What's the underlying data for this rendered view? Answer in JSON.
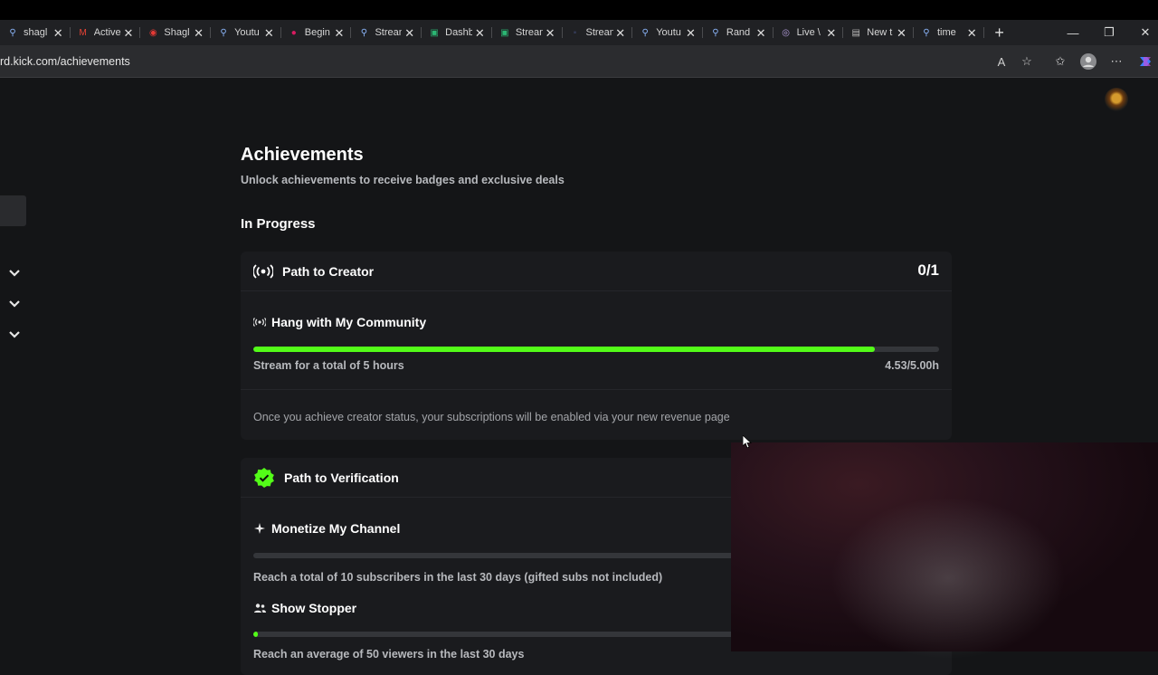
{
  "browser": {
    "tabs": [
      {
        "title": "shagl",
        "icon": "search-icon"
      },
      {
        "title": "Active",
        "icon": "gmail-icon"
      },
      {
        "title": "Shagl",
        "icon": "redcircle-icon"
      },
      {
        "title": "Youtu",
        "icon": "search-icon"
      },
      {
        "title": "Begin",
        "icon": "youtube-icon"
      },
      {
        "title": "Strean",
        "icon": "search-icon"
      },
      {
        "title": "Dashb",
        "icon": "kick-icon"
      },
      {
        "title": "Strean",
        "icon": "kick-icon"
      },
      {
        "title": "Strean",
        "icon": "dark-icon"
      },
      {
        "title": "Youtu",
        "icon": "search-icon"
      },
      {
        "title": "Rand",
        "icon": "search-icon"
      },
      {
        "title": "Live \\",
        "icon": "live-icon"
      },
      {
        "title": "New t",
        "icon": "page-icon"
      },
      {
        "title": "time",
        "icon": "search-icon"
      }
    ],
    "url": "rd.kick.com/achievements"
  },
  "page": {
    "title": "Achievements",
    "subtitle": "Unlock achievements to receive badges and exclusive deals",
    "section": "In Progress"
  },
  "cards": {
    "creator": {
      "name": "Path to Creator",
      "count": "0/1",
      "achievement": {
        "title": "Hang with My Community",
        "desc": "Stream for a total of 5 hours",
        "value": "4.53/5.00h",
        "progress": 0.906
      },
      "note": "Once you achieve creator status, your subscriptions will be enabled via your new revenue page"
    },
    "verification": {
      "name": "Path to Verification",
      "a1": {
        "title": "Monetize My Channel",
        "desc": "Reach a total of 10 subscribers in the last 30 days (gifted subs not included)",
        "progress": 0.0
      },
      "a2": {
        "title": "Show Stopper",
        "desc": "Reach an average of 50 viewers in the last 30 days",
        "progress": 0.006
      }
    }
  },
  "colors": {
    "accent": "#53fc18",
    "bg": "#141517",
    "card": "#1a1b1e"
  }
}
